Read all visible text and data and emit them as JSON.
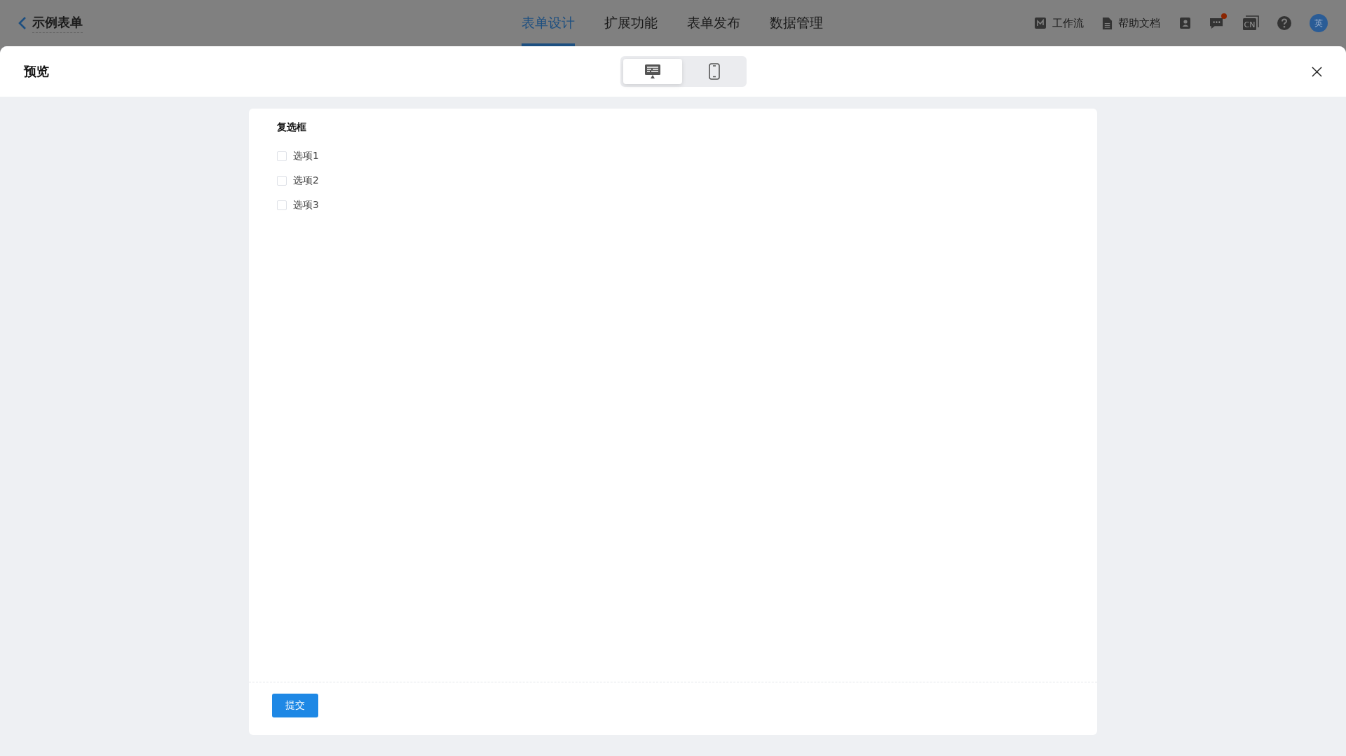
{
  "app_bar": {
    "back_title": "示例表单",
    "tabs": [
      {
        "label": "表单设计",
        "selected": true
      },
      {
        "label": "扩展功能",
        "selected": false
      },
      {
        "label": "表单发布",
        "selected": false
      },
      {
        "label": "数据管理",
        "selected": false
      }
    ],
    "links": [
      {
        "kind": "workflow",
        "label": "工作流"
      },
      {
        "kind": "docs",
        "label": "帮助文档"
      }
    ],
    "language": "CN",
    "avatar": "英",
    "messages_unread": true
  },
  "preview": {
    "title": "预览",
    "devices": [
      {
        "kind": "desktop",
        "selected": true
      },
      {
        "kind": "mobile",
        "selected": false
      }
    ],
    "field": {
      "label": "复选框",
      "options": [
        {
          "label": "选项1",
          "checked": false
        },
        {
          "label": "选项2",
          "checked": false
        },
        {
          "label": "选项3",
          "checked": false
        }
      ]
    },
    "submit": "提交"
  }
}
